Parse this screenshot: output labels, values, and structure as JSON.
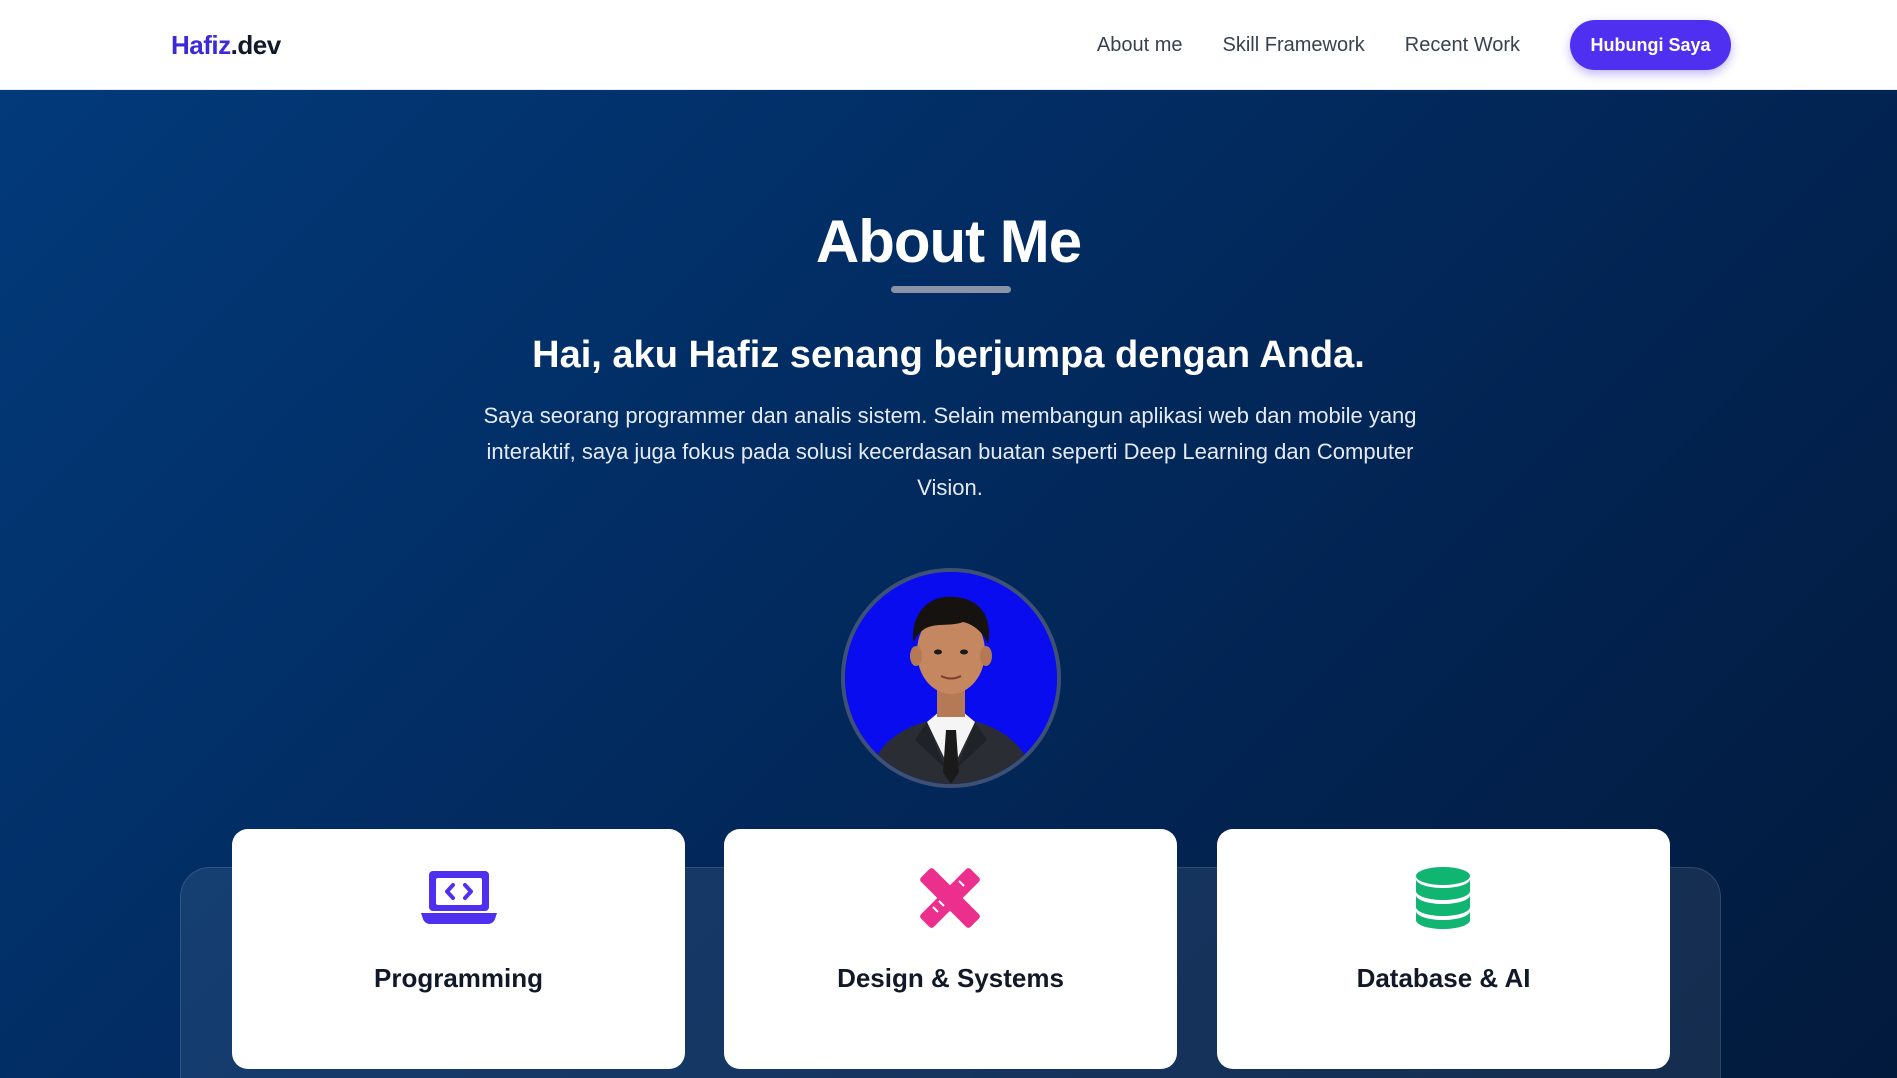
{
  "nav": {
    "logo_brand": "Hafiz",
    "logo_tld": ".dev",
    "links": [
      "About me",
      "Skill Framework",
      "Recent Work"
    ],
    "cta_label": "Hubungi Saya"
  },
  "hero": {
    "title": "About Me",
    "greeting": "Hai, aku Hafiz senang berjumpa dengan Anda.",
    "description": "Saya seorang programmer dan analis sistem. Selain membangun aplikasi web dan mobile yang interaktif, saya juga fokus pada solusi kecerdasan buatan seperti Deep Learning dan Computer Vision."
  },
  "cards": [
    {
      "title": "Programming",
      "icon": "laptop-code-icon",
      "color": "#4f2ff0"
    },
    {
      "title": "Design & Systems",
      "icon": "pencil-ruler-icon",
      "color": "#ec2f8c"
    },
    {
      "title": "Database & AI",
      "icon": "database-icon",
      "color": "#10b572"
    }
  ],
  "colors": {
    "accent": "#4f2ff0",
    "hero_bg": "#022c62",
    "brand": "#3b2ad6"
  }
}
